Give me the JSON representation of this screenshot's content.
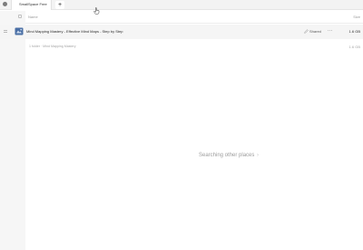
{
  "tabbar": {
    "tab_label": "SmallSpace Free",
    "new_tab_label": "+"
  },
  "list_header": {
    "name_label": "Name",
    "size_label": "Size"
  },
  "file_row": {
    "name": "Mind Mapping Mastery - Effective Mind Maps - Step by Step",
    "shared_label": "Shared",
    "more_label": "···",
    "size": "1.6 GB",
    "icon": "video-file-icon"
  },
  "subfolder_row": {
    "path": "1 folder · Mind Mapping Mastery",
    "size": "1.6 GB"
  },
  "search_status": {
    "text": "Searching other places",
    "arrow": "›"
  },
  "colors": {
    "file_icon": "#4a6fa5",
    "row_highlight": "#f5f5f5",
    "sidebar": "#f6f6f6"
  }
}
